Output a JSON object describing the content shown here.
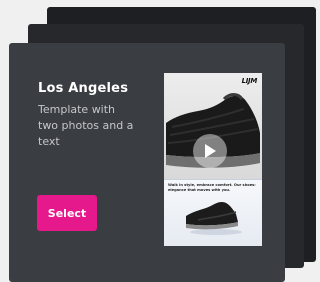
{
  "template": {
    "title": "Los Angeles",
    "description": "Template with two photos and a text",
    "select_label": "Select"
  },
  "preview": {
    "brand": "LIJM",
    "tagline": "Walk in style, embrace comfort. Our shoes: elegance that moves with you.",
    "play_icon": "play-icon"
  },
  "colors": {
    "accent": "#e6198c",
    "card": "#3a3d41",
    "page": "#f0f0f0"
  }
}
